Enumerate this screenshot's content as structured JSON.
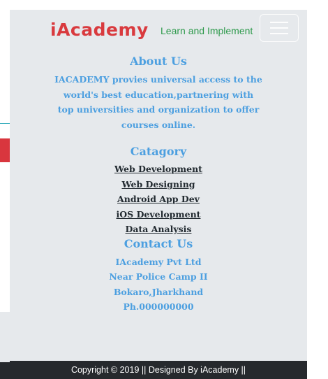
{
  "brand": {
    "name": "iAcademy",
    "tagline": "Learn and Implement"
  },
  "about": {
    "title": "About Us",
    "lines": [
      "IACADEMY provies universal access to the",
      "world's best education,partnering with",
      "top universities and organization to offer",
      "courses online."
    ]
  },
  "category": {
    "title": "Catagory",
    "links": [
      "Web Development",
      "Web Designing",
      "Android App Dev",
      "iOS Development",
      "Data Analysis"
    ]
  },
  "contact": {
    "title": "Contact Us",
    "lines": [
      "IAcademy Pvt Ltd",
      "Near Police Camp II",
      "Bokaro,Jharkhand",
      "Ph.000000000"
    ]
  },
  "footer": {
    "text": "Copyright © 2019 || Designed By iAcademy ||"
  },
  "colors": {
    "brand": "#d93a3e",
    "tagline": "#2e9a4c",
    "accent": "#4c9fe0",
    "footer_bg": "#26292d",
    "panel_bg": "#e6e9ec"
  },
  "icons": {
    "menu": "hamburger-icon"
  }
}
